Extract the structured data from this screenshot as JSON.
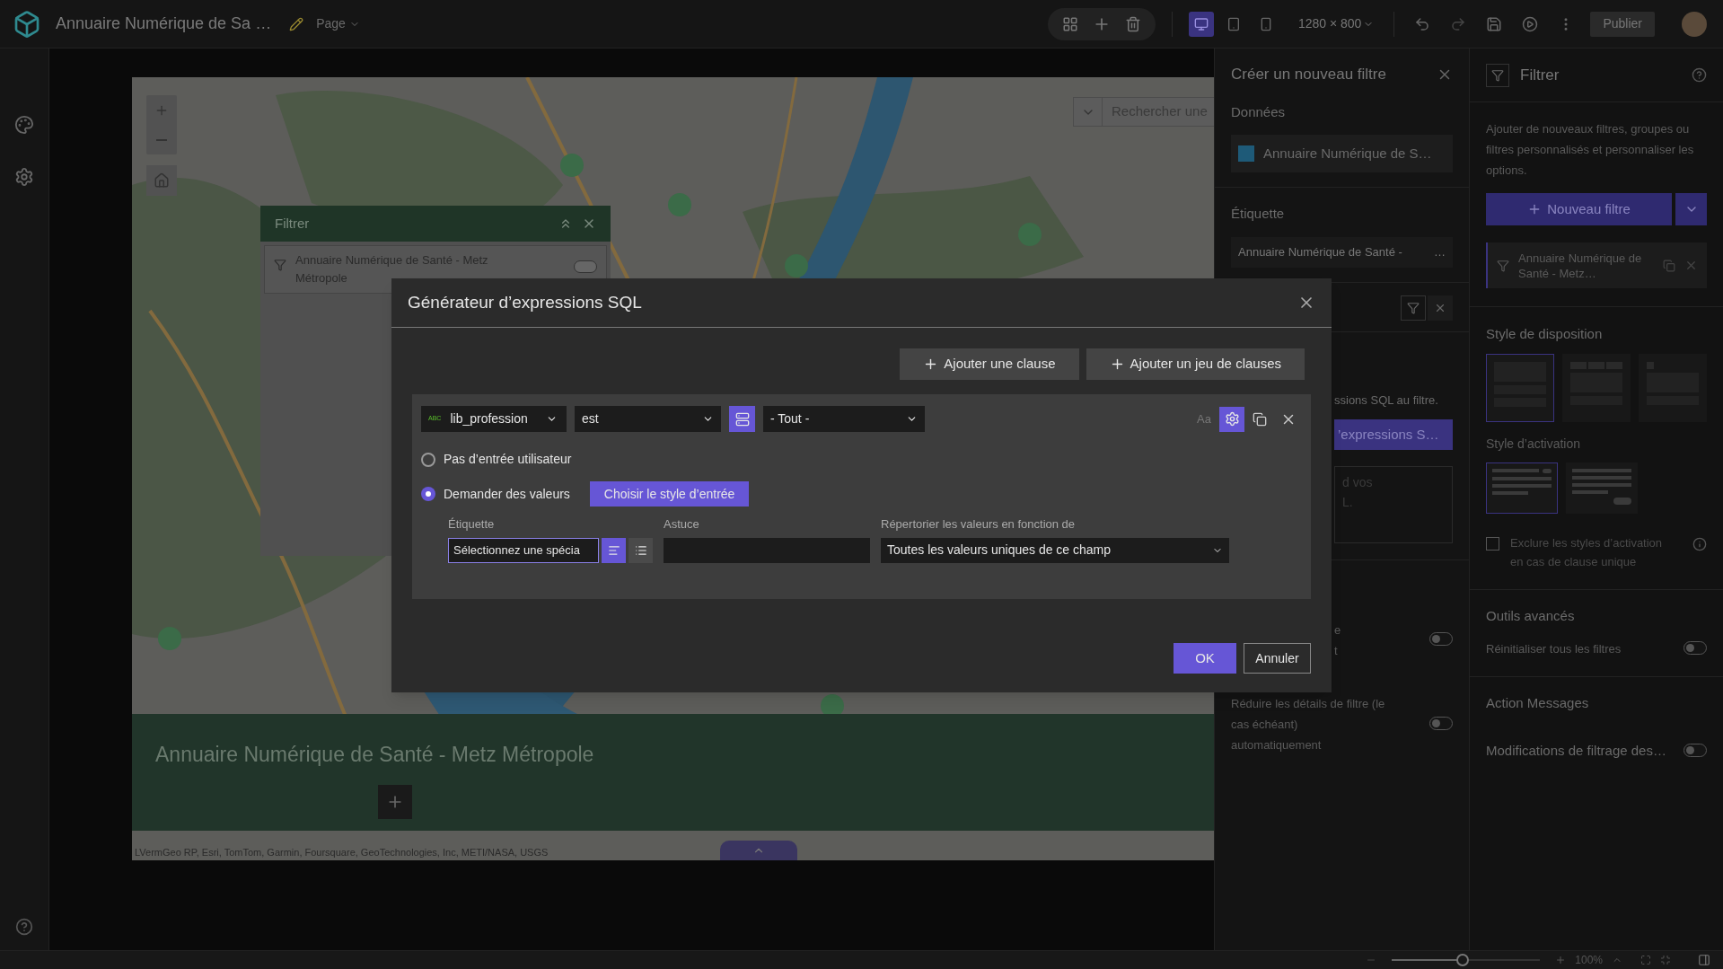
{
  "top_bar": {
    "title": "Annuaire Numérique de Sa …",
    "page_menu": "Page",
    "devices": [
      {
        "kind": "desktop",
        "selected": true
      },
      {
        "kind": "tablet",
        "selected": false
      },
      {
        "kind": "phone",
        "selected": false
      }
    ],
    "resolution": "1280 × 800",
    "publish": "Publier"
  },
  "map": {
    "search_placeholder": "Rechercher une",
    "attribution": "LVermGeo RP, Esri, TomTom, Garmin, Foursquare, GeoTechnologies, Inc, METI/NASA, USGS"
  },
  "map_filter_widget": {
    "title": "Filtrer",
    "item": "Annuaire Numérique de Santé - Metz Métropole"
  },
  "page_band": {
    "title": "Annuaire Numérique de Santé - Metz Métropole"
  },
  "create_filter_panel": {
    "title": "Créer un nouveau filtre",
    "data_label": "Données",
    "data_source": "Annuaire Numérique de S…",
    "label_heading": "Étiquette",
    "label_value": "Annuaire Numérique de Santé -",
    "label_more": "…",
    "sql_hint": "ssions SQL au filtre.",
    "sql_button": "’expressions S…",
    "textarea_lines": [
      "d vos",
      "L."
    ],
    "toggles": [
      {
        "lines": [
          "e",
          "t"
        ],
        "on": false
      },
      {
        "lines": [
          "Réduire les détails de filtre (le",
          "cas échéant)",
          "automatiquement"
        ],
        "on": false
      }
    ]
  },
  "filter_panel": {
    "title": "Filtrer",
    "description": "Ajouter de nouveaux filtres, groupes ou filtres personnalisés et personnaliser les options.",
    "new_filter": "Nouveau filtre",
    "filters": [
      {
        "label": "Annuaire Numérique de Santé - Metz…"
      }
    ],
    "layout_heading": "Style de disposition",
    "layouts": [
      {
        "kind": "vertical",
        "selected": true
      },
      {
        "kind": "horizontal",
        "selected": false
      },
      {
        "kind": "icon",
        "selected": false
      }
    ],
    "activation_heading": "Style d’activation",
    "activations": [
      {
        "kind": "toggle",
        "selected": true
      },
      {
        "kind": "button",
        "selected": false
      }
    ],
    "exclude": {
      "label": "Exclure les styles d’activation en cas de clause unique",
      "checked": false
    },
    "advanced_heading": "Outils avancés",
    "reset": {
      "label": "Réinitialiser tous les filtres",
      "on": false
    },
    "messages_heading": "Action Messages",
    "messages": {
      "label": "Modifications de filtrage des…",
      "on": false
    }
  },
  "dialog": {
    "title": "Générateur d’expressions SQL",
    "add_clause": "Ajouter une clause",
    "add_clause_set": "Ajouter un jeu de clauses",
    "clause": {
      "field_type": "ABC",
      "field": "lib_profession",
      "operator": "est",
      "value": "- Tout -",
      "case_label": "Aa",
      "options": [
        {
          "label": "Pas d’entrée utilisateur",
          "selected": false
        },
        {
          "label": "Demander des valeurs",
          "selected": true
        }
      ],
      "style_button": "Choisir le style d’entrée",
      "label_heading": "Étiquette",
      "label_value": "Sélectionnez une spécia",
      "label_styles": [
        {
          "kind": "align",
          "selected": true
        },
        {
          "kind": "list",
          "selected": false
        }
      ],
      "hint_heading": "Astuce",
      "list_heading": "Répertorier les valeurs en fonction de",
      "list_value": "Toutes les valeurs uniques de ce champ"
    },
    "ok": "OK",
    "cancel": "Annuler"
  },
  "status_bar": {
    "zoom": "100%",
    "level": 0.48
  }
}
